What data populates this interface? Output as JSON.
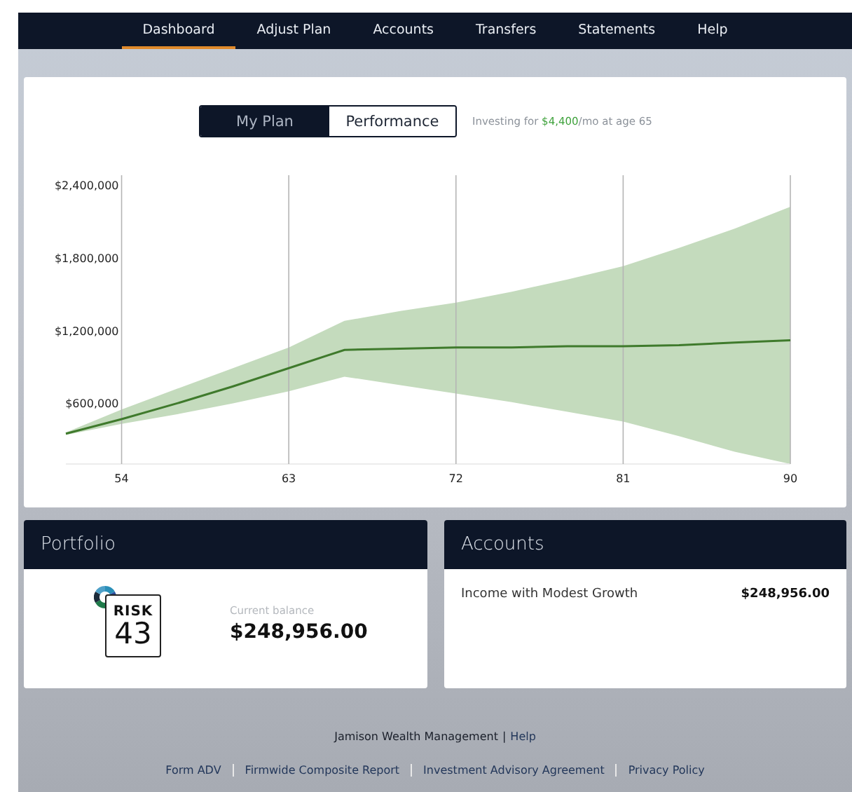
{
  "nav": [
    {
      "label": "Dashboard",
      "selected": true
    },
    {
      "label": "Adjust Plan",
      "selected": false
    },
    {
      "label": "Accounts",
      "selected": false
    },
    {
      "label": "Transfers",
      "selected": false
    },
    {
      "label": "Statements",
      "selected": false
    },
    {
      "label": "Help",
      "selected": false
    }
  ],
  "plan_card": {
    "toggle": [
      {
        "label": "My Plan",
        "selected": true
      },
      {
        "label": "Performance",
        "selected": false
      }
    ],
    "summary": {
      "prefix": "Investing for ",
      "amount": "$4,400",
      "suffix": "/mo at age 65"
    },
    "chart_data": {
      "type": "area",
      "x": [
        51,
        54,
        57,
        60,
        63,
        66,
        69,
        72,
        75,
        78,
        81,
        84,
        87,
        90
      ],
      "xticks": [
        54,
        63,
        72,
        81,
        90
      ],
      "yticks": [
        {
          "value": 600000,
          "label": "$600,000"
        },
        {
          "value": 1200000,
          "label": "$1,200,000"
        },
        {
          "value": 1800000,
          "label": "$1,800,000"
        },
        {
          "value": 2400000,
          "label": "$2,400,000"
        }
      ],
      "xlim": [
        51,
        90
      ],
      "ylim": [
        100000,
        2480000
      ],
      "grid": true,
      "series": [
        {
          "color": "#c4dbbd",
          "values": [
            360000,
            550000,
            720000,
            890000,
            1060000,
            1280000,
            1360000,
            1430000,
            1520000,
            1620000,
            1730000,
            1880000,
            2040000,
            2220000
          ]
        },
        {
          "color": "#ffffff",
          "values": [
            340000,
            430000,
            510000,
            600000,
            700000,
            820000,
            750000,
            680000,
            610000,
            530000,
            450000,
            330000,
            200000,
            100000
          ]
        },
        {
          "type": "line",
          "color": "#3f7a2c",
          "values": [
            350000,
            470000,
            600000,
            740000,
            890000,
            1040000,
            1050000,
            1060000,
            1060000,
            1070000,
            1070000,
            1080000,
            1100000,
            1120000
          ]
        }
      ]
    }
  },
  "portfolio": {
    "title": "Portfolio",
    "risk_label": "RISK",
    "risk_score": "43",
    "balance_label": "Current balance",
    "balance": "$248,956.00"
  },
  "accounts": {
    "title": "Accounts",
    "rows": [
      {
        "name": "Income with Modest Growth",
        "balance": "$248,956.00"
      }
    ]
  },
  "footer": {
    "firm": "Jamison Wealth Management",
    "separator": "|",
    "help": "Help",
    "links": [
      "Form ADV",
      "Firmwide Composite Report",
      "Investment Advisory Agreement",
      "Privacy Policy"
    ]
  }
}
